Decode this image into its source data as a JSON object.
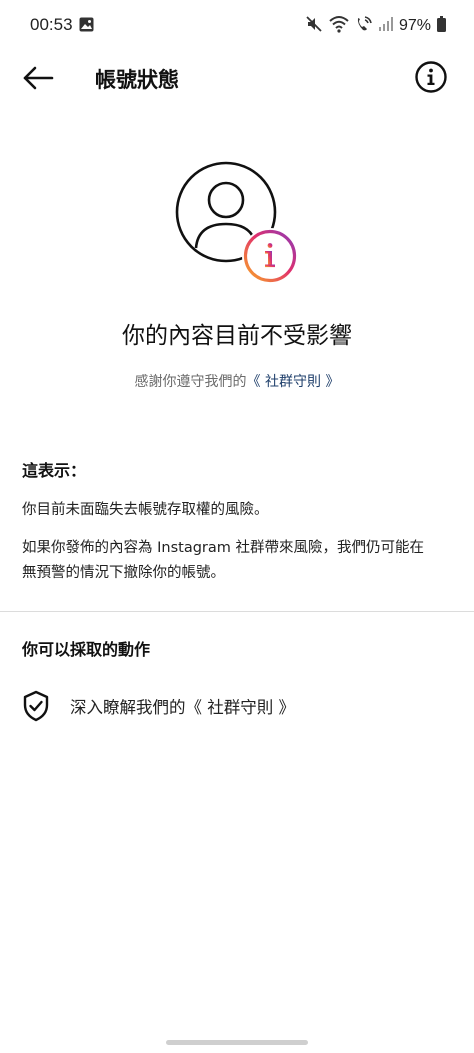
{
  "status_bar": {
    "time": "00:53",
    "battery": "97%",
    "icons": [
      "image-icon",
      "mute-icon",
      "wifi-icon",
      "wifi-call-icon",
      "signal-icon",
      "battery-icon"
    ]
  },
  "header": {
    "back_icon": "arrow-left-icon",
    "title": "帳號狀態",
    "info_icon": "info-circle-icon"
  },
  "hero": {
    "avatar_icon": "profile-outline-icon",
    "badge_icon": "info-badge-icon",
    "headline": "你的內容目前不受影響",
    "subtitle_prefix": "感謝你遵守我們的",
    "subtitle_link": "《 社群守則 》"
  },
  "meaning": {
    "heading": "這表示：",
    "paragraph_1": "你目前未面臨失去帳號存取權的風險。",
    "paragraph_2_line_1": "如果你發佈的內容為 Instagram 社群帶來風險，我們仍可能在",
    "paragraph_2_line_2": "無預警的情況下撤除你的帳號。"
  },
  "actions": {
    "heading": "你可以採取的動作",
    "items": [
      {
        "icon": "shield-check-icon",
        "label": "深入瞭解我們的《 社群守則 》"
      }
    ]
  },
  "colors": {
    "gradient_start": "#f9a826",
    "gradient_mid": "#e1306c",
    "gradient_end": "#8a3ab9",
    "link": "#1f3f6b"
  }
}
